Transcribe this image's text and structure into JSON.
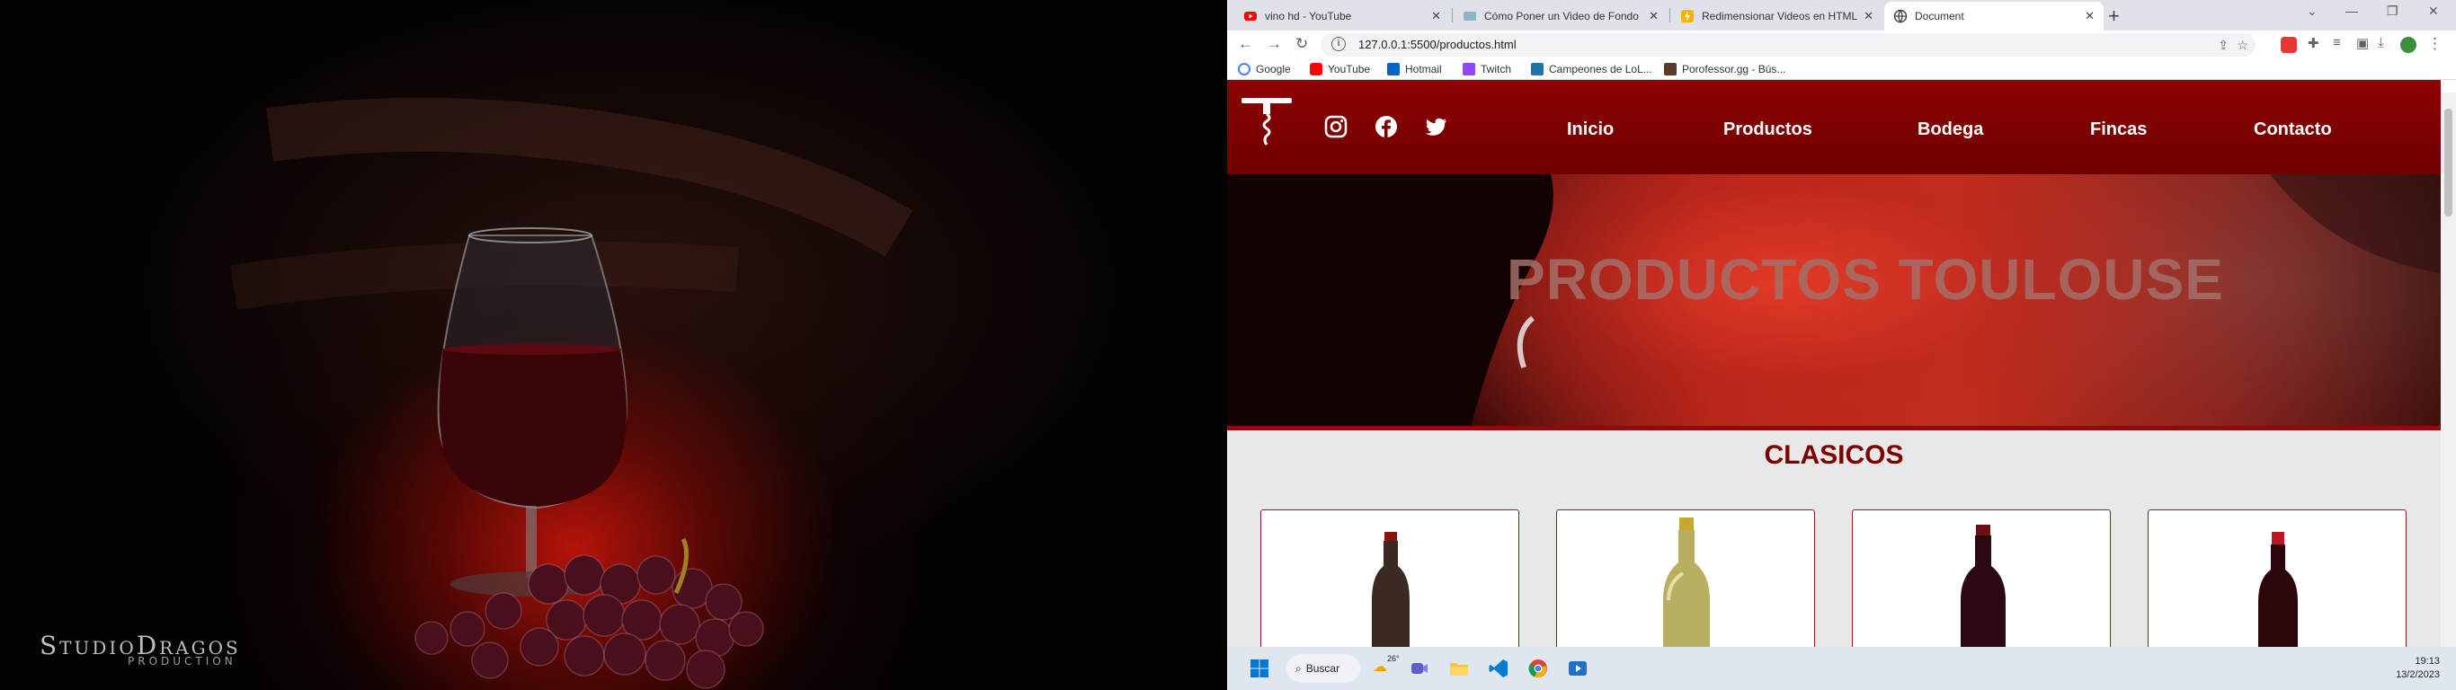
{
  "wallpaper": {
    "logo_text": "StudioDragos",
    "logo_sub": "PRODUCTION"
  },
  "browser": {
    "tabs": [
      {
        "title": "vino hd - YouTube",
        "icon": "youtube-icon"
      },
      {
        "title": "Cómo Poner un Video de Fondo",
        "icon": "video-icon"
      },
      {
        "title": "Redimensionar Videos en HTML",
        "icon": "lightning-icon"
      },
      {
        "title": "Document",
        "icon": "globe-icon",
        "active": true
      }
    ],
    "url": "127.0.0.1:5500/productos.html",
    "bookmarks": [
      {
        "label": "Google",
        "color": "#4285f4"
      },
      {
        "label": "YouTube",
        "color": "#ff0000"
      },
      {
        "label": "Hotmail",
        "color": "#0a64c8"
      },
      {
        "label": "Twitch",
        "color": "#9146ff"
      },
      {
        "label": "Campeones de LoL...",
        "color": "#1e73a8"
      },
      {
        "label": "Porofessor.gg - Bús...",
        "color": "#5a3b2a"
      }
    ]
  },
  "site": {
    "menu": [
      "Inicio",
      "Productos",
      "Bodega",
      "Fincas",
      "Contacto"
    ],
    "hero_title": "PRODUCTOS TOULOUSE",
    "section_title": "CLASICOS",
    "brand_color": "#7d0000"
  },
  "taskbar": {
    "search_label": "Buscar",
    "weather": "26°",
    "time": "19:13",
    "date": "13/2/2023"
  }
}
